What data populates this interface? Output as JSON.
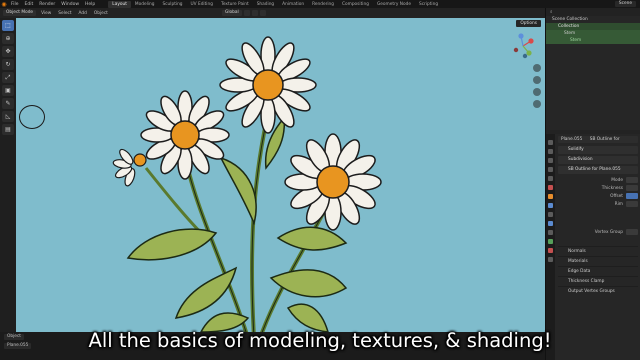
{
  "topbar": {
    "menus": [
      "File",
      "Edit",
      "Render",
      "Window",
      "Help"
    ],
    "workspaces": [
      "Layout",
      "Modeling",
      "Sculpting",
      "UV Editing",
      "Texture Paint",
      "Shading",
      "Animation",
      "Rendering",
      "Compositing",
      "Geometry Node",
      "Scripting"
    ],
    "active_workspace": "Layout",
    "scene_label": "Scene"
  },
  "header": {
    "mode": "Object Mode",
    "menus": [
      "View",
      "Select",
      "Add",
      "Object"
    ],
    "orientation": "Global"
  },
  "viewport": {
    "options_label": "Options",
    "background_color": "#7fbccc"
  },
  "outliner": {
    "title": "Scene Collection",
    "rows": [
      "Scene Collection",
      "Collection",
      "Stem",
      "Stem"
    ]
  },
  "properties": {
    "object_name": "Plane.055",
    "search_field": "SB Outline for",
    "modifiers": [
      "Solidify",
      "Subdivision",
      "SB Outline for Plane.055"
    ],
    "props": [
      "Mode",
      "Thickness",
      "Offset",
      "Rim"
    ],
    "vertex_group": "Vertex Group",
    "panels": [
      "Normals",
      "Materials",
      "Edge Data",
      "Thickness Clamp",
      "Output Vertex Groups"
    ]
  },
  "bottombar": {
    "object_label": "Object",
    "plane_label": "Plane.055"
  },
  "subtitle": "All the basics of modeling, textures, & shading!",
  "icons": {
    "logo": "blender-logo-icon",
    "tools": [
      "select-box-icon",
      "cursor-icon",
      "move-icon",
      "rotate-icon",
      "scale-icon",
      "transform-icon",
      "annotate-icon",
      "measure-icon",
      "add-cube-icon"
    ]
  }
}
